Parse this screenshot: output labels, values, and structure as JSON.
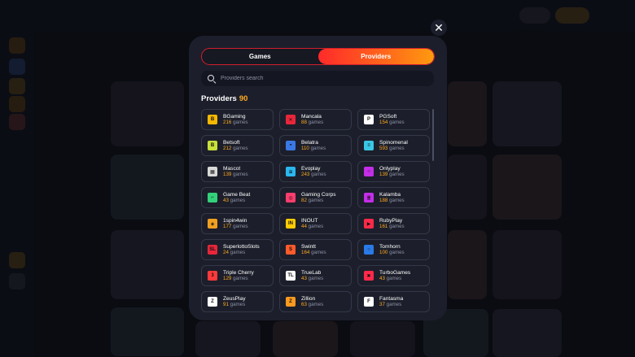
{
  "modal": {
    "close_icon": "close-icon",
    "tabs": [
      {
        "label": "Games",
        "active": false
      },
      {
        "label": "Providers",
        "active": true
      }
    ],
    "search": {
      "placeholder": "Providers search",
      "icon": "search-icon"
    },
    "section": {
      "label": "Providers",
      "count": "90"
    },
    "providers_suffix": "games",
    "providers": [
      {
        "name": "BGaming",
        "count": "216",
        "logo_color": "#f5b800",
        "logo_text": "B"
      },
      {
        "name": "Mancala",
        "count": "88",
        "logo_color": "#e8263a",
        "logo_text": "✕"
      },
      {
        "name": "PGSoft",
        "count": "154",
        "logo_color": "#ffffff",
        "logo_text": "P"
      },
      {
        "name": "Betsoft",
        "count": "212",
        "logo_color": "#c8e03a",
        "logo_text": "B"
      },
      {
        "name": "Belatra",
        "count": "110",
        "logo_color": "#3a78e6",
        "logo_text": "◓"
      },
      {
        "name": "Spinomenal",
        "count": "593",
        "logo_color": "#3ac7e6",
        "logo_text": "≡"
      },
      {
        "name": "Mascot",
        "count": "139",
        "logo_color": "#d9d9d9",
        "logo_text": "▦"
      },
      {
        "name": "Evoplay",
        "count": "243",
        "logo_color": "#2ab7f0",
        "logo_text": "≋"
      },
      {
        "name": "Onlyplay",
        "count": "139",
        "logo_color": "#c42ee8",
        "logo_text": "○"
      },
      {
        "name": "Game Beat",
        "count": "43",
        "logo_color": "#33d17a",
        "logo_text": "⌐"
      },
      {
        "name": "Gaming Corps",
        "count": "82",
        "logo_color": "#ff3d6e",
        "logo_text": "◎"
      },
      {
        "name": "Kalamba",
        "count": "188",
        "logo_color": "#c42ee8",
        "logo_text": "≣"
      },
      {
        "name": "1spin4win",
        "count": "177",
        "logo_color": "#f0a020",
        "logo_text": "◈"
      },
      {
        "name": "INOUT",
        "count": "44",
        "logo_color": "#ffcc00",
        "logo_text": "IN"
      },
      {
        "name": "RubyPlay",
        "count": "161",
        "logo_color": "#ff2a4a",
        "logo_text": "▶"
      },
      {
        "name": "SuperlottoSlots",
        "count": "24",
        "logo_color": "#e8263a",
        "logo_text": "SL"
      },
      {
        "name": "Swintt",
        "count": "164",
        "logo_color": "#ff5a2a",
        "logo_text": "S"
      },
      {
        "name": "Tomhorn",
        "count": "100",
        "logo_color": "#2a7ae8",
        "logo_text": "○"
      },
      {
        "name": "Triple Cherry",
        "count": "129",
        "logo_color": "#ff3a3a",
        "logo_text": "3"
      },
      {
        "name": "TrueLab",
        "count": "43",
        "logo_color": "#ffffff",
        "logo_text": "TL"
      },
      {
        "name": "TurboGames",
        "count": "43",
        "logo_color": "#ff2a4a",
        "logo_text": "✖"
      },
      {
        "name": "ZeusPlay",
        "count": "91",
        "logo_color": "#ffffff",
        "logo_text": "Z"
      },
      {
        "name": "Zillion",
        "count": "63",
        "logo_color": "#ff9a1f",
        "logo_text": "Z"
      },
      {
        "name": "Fantasma",
        "count": "37",
        "logo_color": "#ffffff",
        "logo_text": "F"
      }
    ]
  }
}
